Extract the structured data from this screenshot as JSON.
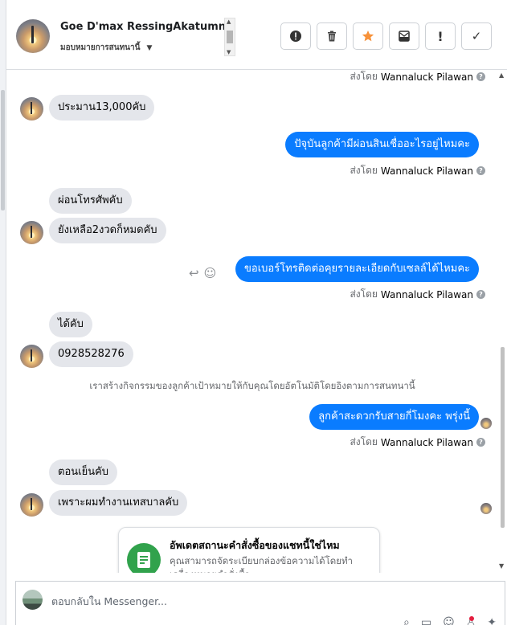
{
  "header": {
    "name": "Goe D'max RessingAkatumnaue",
    "subtitle": "มอบหมายการสนทนานี้",
    "actions": [
      {
        "icon": "alert-circle-icon",
        "glyph": "!"
      },
      {
        "icon": "trash-icon",
        "glyph": ""
      },
      {
        "icon": "star-icon",
        "glyph": "★"
      },
      {
        "icon": "archive-icon",
        "glyph": ""
      },
      {
        "icon": "exclamation-icon",
        "glyph": "!"
      },
      {
        "icon": "check-icon",
        "glyph": "✓"
      }
    ]
  },
  "messages": {
    "sent_by_label": "ส่งโดย",
    "agent_name": "Wannaluck Pilawan",
    "m1": "ประมาน13,000คับ",
    "m2": "ปัจุบันลูกค้ามีผ่อนสินเชื่ออะไรอยู่ไหมคะ",
    "m3": "ผ่อนโทรศัพคับ",
    "m4": "ยังเหลือ2งวดก็หมดคับ",
    "m5": "ขอเบอร์โทรติดต่อคุยรายละเอียดกับเซลล์ได้ไหมคะ",
    "m6": "ได้คับ",
    "m7": "0928528276",
    "system": "เราสร้างกิจกรรมของลูกค้าเป้าหมายให้กับคุณโดยอัตโนมัติโดยอิงตามการสนทนานี้",
    "m8": "ลูกค้าสะดวกรับสายกี่โมงคะ พรุ่งนี้",
    "m9": "ตอนเย็นคับ",
    "m10": "เพราะผมทำงานเทสบาลคับ"
  },
  "card": {
    "title": "อัพเดตสถานะคำสั่งซื้อของแชทนี้ใช่ไหม",
    "description": "คุณสามารถจัดระเบียบกล่องข้อความได้โดยทำเครื่องหมายคำสั่งซื้อ..."
  },
  "composer": {
    "placeholder": "ตอบกลับใน Messenger..."
  },
  "colors": {
    "outgoing_bubble": "#0a7cff",
    "incoming_bubble": "#e4e6eb",
    "card_icon": "#31a24c",
    "star": "#f7923a"
  }
}
